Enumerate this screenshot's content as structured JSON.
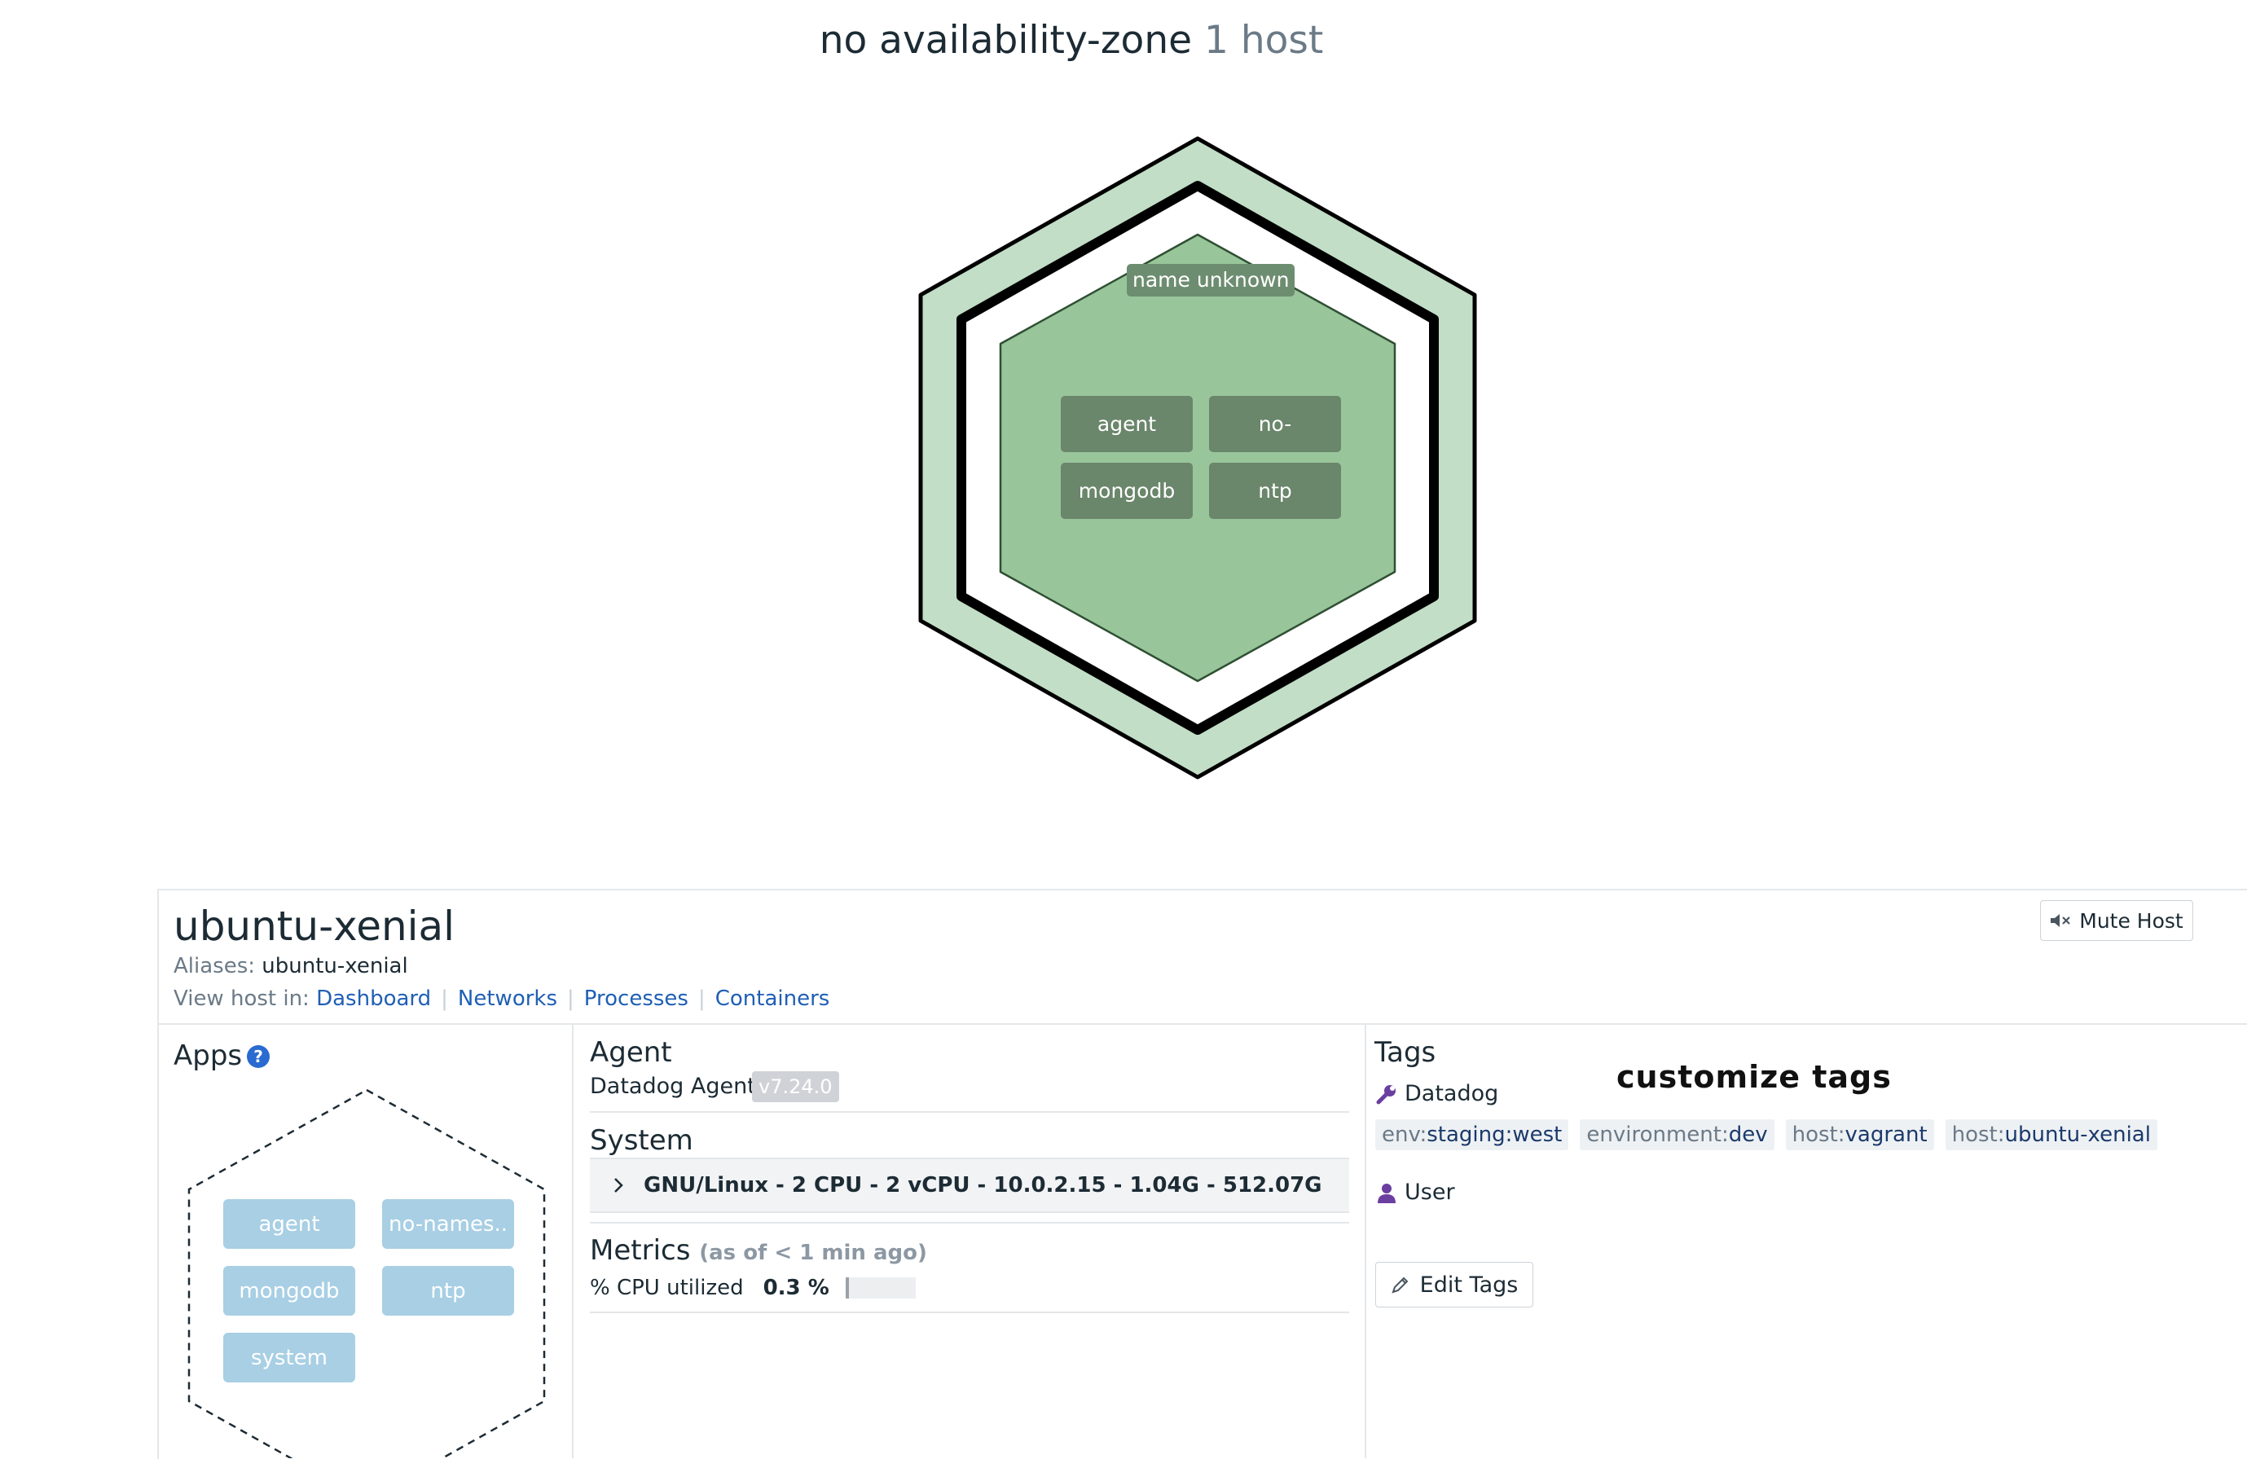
{
  "zone": {
    "name": "no availability-zone",
    "count": "1 host"
  },
  "hex": {
    "label": "name unknown",
    "apps": [
      "agent",
      "no-",
      "mongodb",
      "ntp"
    ],
    "colors": {
      "outer": "#c2dec6",
      "inner": "#98c59a",
      "tile": "#6a866b"
    }
  },
  "host": {
    "name": "ubuntu-xenial",
    "aliases_label": "Aliases:",
    "aliases_value": "ubuntu-xenial",
    "view_label": "View host in:",
    "links": [
      "Dashboard",
      "Networks",
      "Processes",
      "Containers"
    ],
    "mute_label": "Mute Host"
  },
  "apps": {
    "title": "Apps",
    "help": "?",
    "items": [
      "agent",
      "no-names..",
      "mongodb",
      "ntp",
      "system"
    ]
  },
  "agent": {
    "title": "Agent",
    "label": "Datadog Agent:",
    "version": "v7.24.0"
  },
  "system": {
    "title": "System",
    "summary": "GNU/Linux - 2 CPU - 2 vCPU - 10.0.2.15 - 1.04G - 512.07G"
  },
  "metrics": {
    "title": "Metrics",
    "subtitle": "(as of < 1 min ago)",
    "cpu_label": "% CPU utilized",
    "cpu_value": "0.3 %",
    "cpu_fraction": 0.05
  },
  "tags": {
    "title": "Tags",
    "customize": "customize tags",
    "datadog_label": "Datadog",
    "user_label": "User",
    "edit_label": "Edit Tags",
    "list": [
      {
        "k": "env:",
        "v": "staging:west"
      },
      {
        "k": "environment:",
        "v": "dev"
      },
      {
        "k": "host:",
        "v": "vagrant"
      },
      {
        "k": "host:",
        "v": "ubuntu-xenial"
      }
    ],
    "icon_color": "#6a3fa0"
  }
}
